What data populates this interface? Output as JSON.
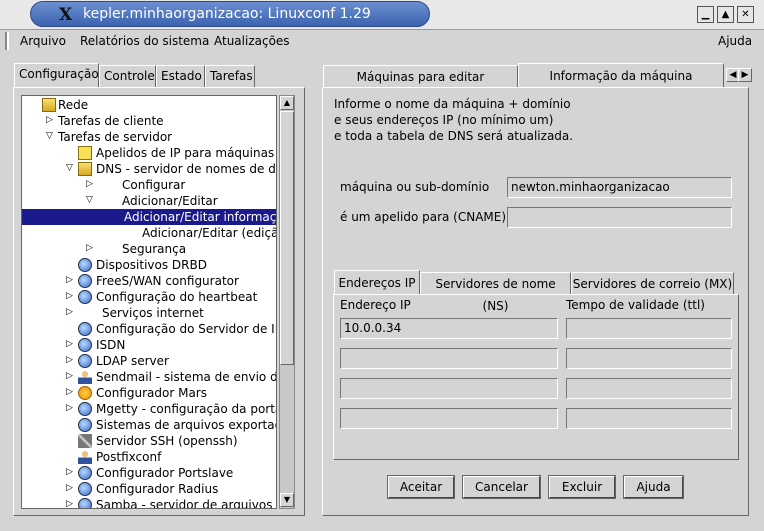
{
  "window": {
    "title": "kepler.minhaorganizacao: Linuxconf 1.29",
    "logo": "X"
  },
  "menu": {
    "items": [
      "Arquivo",
      "Relatórios do sistema",
      "Atualizações"
    ],
    "help": "Ajuda"
  },
  "left_tabs": [
    "Configuração",
    "Controle",
    "Estado",
    "Tarefas"
  ],
  "tree": [
    {
      "label": "Rede",
      "icon": "folder-icon",
      "toggle": "open"
    },
    {
      "label": "Tarefas de cliente",
      "toggle": "closed"
    },
    {
      "label": "Tarefas de servidor",
      "toggle": "open"
    },
    {
      "label": "Apelidos de IP para máquinas v",
      "icon": "document-icon"
    },
    {
      "label": "DNS - servidor de nomes de do",
      "icon": "folder-icon",
      "toggle": "open"
    },
    {
      "label": "Configurar",
      "toggle": "closed"
    },
    {
      "label": "Adicionar/Editar",
      "toggle": "open"
    },
    {
      "label": "Adicionar/Editar informaçõe",
      "selected": true
    },
    {
      "label": "Adicionar/Editar (edição ráp"
    },
    {
      "label": "Segurança",
      "toggle": "closed"
    },
    {
      "label": "Dispositivos DRBD",
      "icon": "globe-icon"
    },
    {
      "label": "FreeS/WAN configurator",
      "icon": "globe-icon",
      "toggle": "closed"
    },
    {
      "label": "Configuração do heartbeat",
      "icon": "globe-icon",
      "toggle": "closed"
    },
    {
      "label": "Serviços internet",
      "toggle": "closed"
    },
    {
      "label": "Configuração do Servidor de IF",
      "icon": "globe-icon"
    },
    {
      "label": "ISDN",
      "icon": "globe-icon",
      "toggle": "closed"
    },
    {
      "label": "LDAP server",
      "icon": "globe-icon",
      "toggle": "closed"
    },
    {
      "label": "Sendmail - sistema de envio de",
      "icon": "person-icon",
      "toggle": "closed"
    },
    {
      "label": "Configurador Mars",
      "icon": "sun-icon",
      "toggle": "closed"
    },
    {
      "label": "Mgetty - configuração da porta",
      "icon": "globe-icon",
      "toggle": "closed"
    },
    {
      "label": "Sistemas de arquivos exportad",
      "icon": "globe-icon"
    },
    {
      "label": "Servidor SSH (openssh)",
      "icon": "tools-icon"
    },
    {
      "label": "Postfixconf",
      "icon": "person-icon"
    },
    {
      "label": "Configurador Portslave",
      "icon": "globe-icon",
      "toggle": "closed"
    },
    {
      "label": "Configurador Radius",
      "icon": "globe-icon",
      "toggle": "closed"
    },
    {
      "label": "Samba - servidor de arquivos",
      "icon": "globe-icon",
      "toggle": "closed"
    }
  ],
  "right_tabs": [
    "Máquinas para editar",
    "Informação da máquina"
  ],
  "info": {
    "line1": "Informe o nome da máquina + domínio",
    "line2": "e seus endereços IP (no mínimo um)",
    "line3": "e toda a tabela de DNS será atualizada."
  },
  "form": {
    "host_label": "máquina ou sub-domínio",
    "host_value": "newton.minhaorganizacao",
    "cname_label": "é um apelido para (CNAME)",
    "cname_value": ""
  },
  "inner_tabs": [
    "Endereços IP",
    "Servidores de nome (NS)",
    "Servidores de correio (MX)"
  ],
  "ip_table": {
    "headers": [
      "Endereço IP",
      "Tempo de validade (ttl)"
    ],
    "rows": [
      [
        "10.0.0.34",
        ""
      ],
      [
        "",
        ""
      ],
      [
        "",
        ""
      ],
      [
        "",
        ""
      ]
    ]
  },
  "buttons": [
    "Aceitar",
    "Cancelar",
    "Excluir",
    "Ajuda"
  ]
}
